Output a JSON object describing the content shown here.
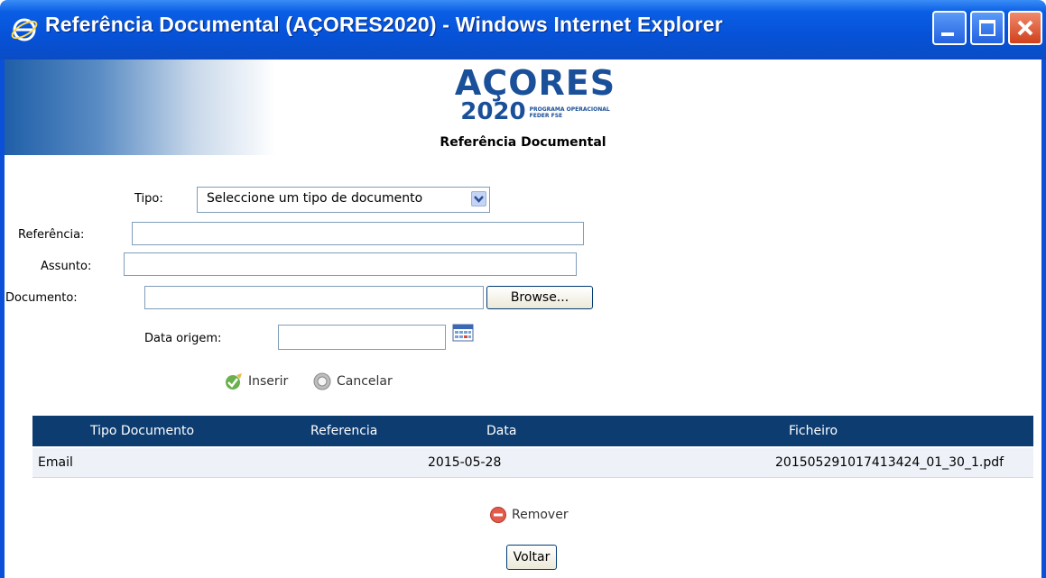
{
  "window": {
    "title": "Referência Documental (AÇORES2020) - Windows Internet Explorer"
  },
  "header": {
    "logo_main": "AÇORES",
    "logo_year": "2020",
    "logo_small_line1": "PROGRAMA OPERACIONAL",
    "logo_small_line2": "FEDER FSE",
    "page_title": "Referência Documental"
  },
  "form": {
    "tipo_label": "Tipo:",
    "tipo_value": "Seleccione um tipo de documento",
    "referencia_label": "Referência:",
    "referencia_value": "",
    "assunto_label": "Assunto:",
    "assunto_value": "",
    "documento_label": "Documento:",
    "documento_value": "",
    "browse_label": "Browse...",
    "data_origem_label": "Data origem:",
    "data_origem_value": "",
    "inserir_label": "Inserir",
    "cancelar_label": "Cancelar"
  },
  "table": {
    "headers": [
      "Tipo Documento",
      "Referencia",
      "Data",
      "Ficheiro"
    ],
    "rows": [
      {
        "tipo": "Email",
        "referencia": "",
        "data": "2015-05-28",
        "ficheiro": "201505291017413424_01_30_1.pdf"
      }
    ]
  },
  "actions": {
    "remover_label": "Remover",
    "voltar_label": "Voltar"
  },
  "colors": {
    "titlebar": "#0652d8",
    "table_header": "#0c3c70",
    "brand": "#1a4f99"
  }
}
